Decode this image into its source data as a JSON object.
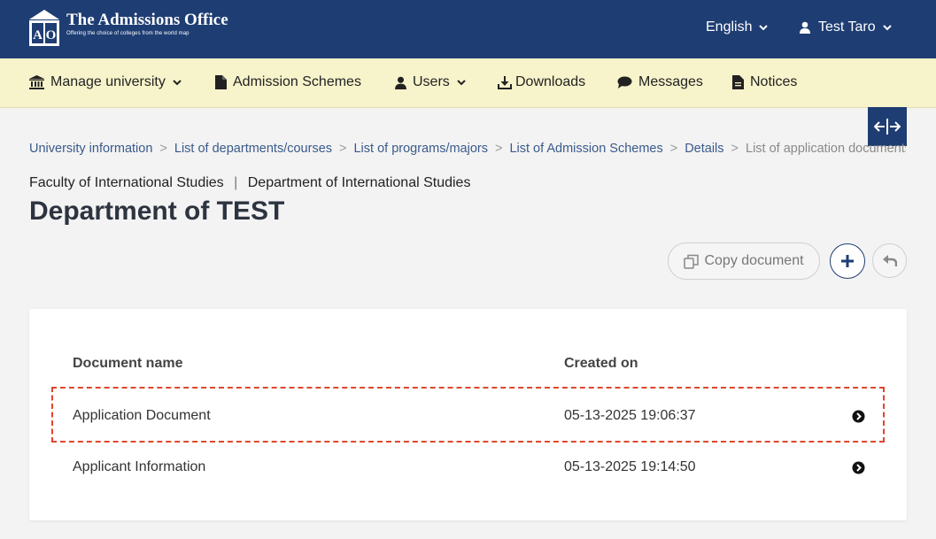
{
  "header": {
    "logo_title": "The Admissions Office",
    "logo_subtitle": "Offering the choice of colleges from the world map",
    "logo_mark": "AO",
    "language": "English",
    "user": "Test Taro"
  },
  "nav": {
    "items": [
      {
        "label": "Manage university",
        "icon": "institution-icon"
      },
      {
        "label": "Admission Schemes",
        "icon": "document-icon"
      },
      {
        "label": "Users",
        "icon": "user-icon"
      },
      {
        "label": "Downloads",
        "icon": "download-icon"
      },
      {
        "label": "Messages",
        "icon": "chat-icon"
      },
      {
        "label": "Notices",
        "icon": "notice-icon"
      }
    ]
  },
  "breadcrumb": {
    "items": [
      "University information",
      "List of departments/courses",
      "List of programs/majors",
      "List of Admission Schemes",
      "Details"
    ],
    "current": "List of application documents"
  },
  "context": {
    "faculty": "Faculty of International Studies",
    "department": "Department of International Studies"
  },
  "page": {
    "title": "Department of TEST"
  },
  "actions": {
    "copy_label": "Copy document"
  },
  "table": {
    "columns": [
      "Document name",
      "Created on"
    ],
    "rows": [
      {
        "name": "Application Document",
        "created": "05-13-2025 19:06:37"
      },
      {
        "name": "Applicant Information",
        "created": "05-13-2025 19:14:50"
      }
    ]
  },
  "colors": {
    "header_bg": "#1e3d73",
    "nav_bg": "#f7f3cb",
    "highlight": "#e0452e"
  }
}
